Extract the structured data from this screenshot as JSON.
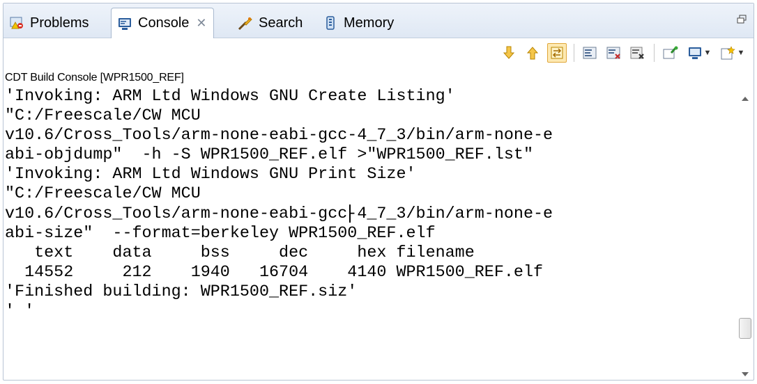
{
  "tabs": [
    {
      "label": "Problems",
      "icon": "problems-icon"
    },
    {
      "label": "Console",
      "icon": "console-icon",
      "active": true,
      "close": "✕"
    },
    {
      "label": "Search",
      "icon": "search-icon"
    },
    {
      "label": "Memory",
      "icon": "memory-icon"
    }
  ],
  "toolbar": {
    "buttons": [
      "scroll-down-icon",
      "scroll-up-icon",
      "scroll-lock-icon",
      "clear-console-icon",
      "remove-launch-icon",
      "remove-all-launches-icon",
      "pin-console-icon",
      "display-console-icon",
      "open-console-icon"
    ],
    "pressed": "scroll-lock-icon"
  },
  "console": {
    "title": "CDT Build Console [WPR1500_REF]",
    "lines": [
      "'Invoking: ARM Ltd Windows GNU Create Listing'",
      "\"C:/Freescale/CW MCU",
      "v10.6/Cross_Tools/arm-none-eabi-gcc-4_7_3/bin/arm-none-e",
      "abi-objdump\"  -h -S WPR1500_REF.elf >\"WPR1500_REF.lst\"",
      "'Invoking: ARM Ltd Windows GNU Print Size'",
      "\"C:/Freescale/CW MCU",
      "v10.6/Cross_Tools/arm-none-eabi-gcc-4_7_3/bin/arm-none-e",
      "abi-size\"  --format=berkeley WPR1500_REF.elf",
      "   text    data     bss     dec     hex filename",
      "  14552     212    1940   16704    4140 WPR1500_REF.elf",
      "'Finished building: WPR1500_REF.siz'",
      "' '"
    ]
  }
}
